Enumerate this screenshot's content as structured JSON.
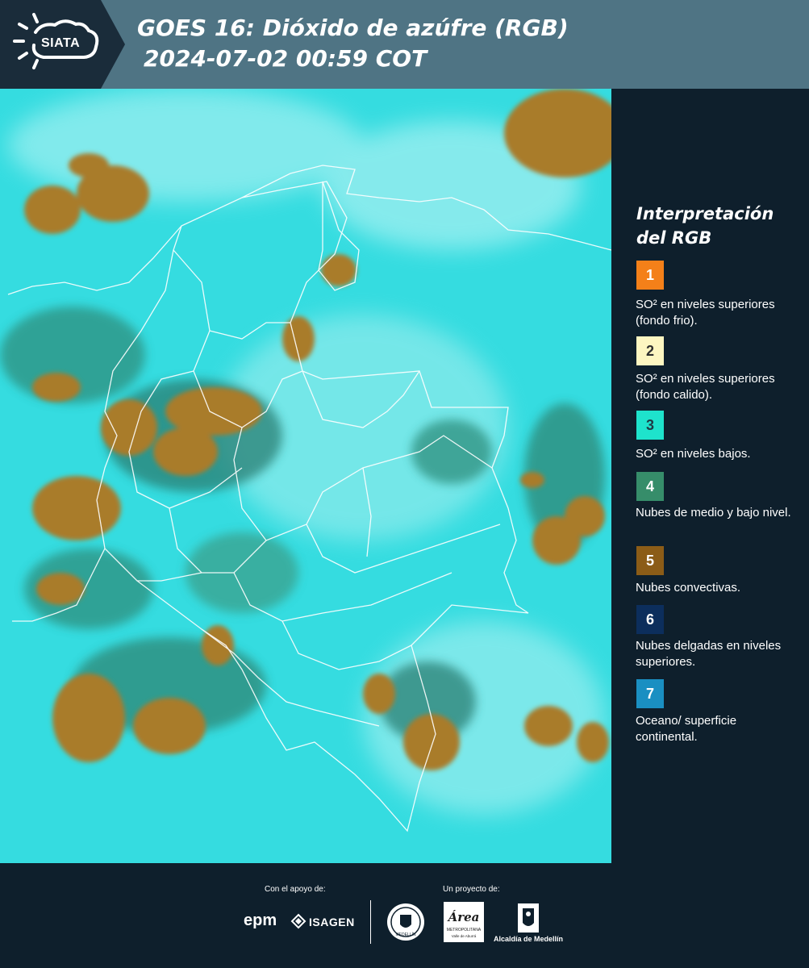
{
  "header": {
    "logo_text": "SIATA",
    "title_line1": "GOES 16: Dióxido de azúfre (RGB)",
    "title_line2": "2024-07-02 00:59 COT"
  },
  "map": {
    "ocean_background_color": "#35dce0",
    "convective_cloud_color": "#a97c2c",
    "border_color": "#ffffff"
  },
  "legend": {
    "title": "Interpretación del RGB",
    "items": [
      {
        "number": "1",
        "color": "#f48019",
        "text_color": "#ffffff",
        "label": "SO² en niveles superiores (fondo frio)."
      },
      {
        "number": "2",
        "color": "#fdf6c1",
        "text_color": "#2e2e2e",
        "label": "SO² en niveles superiores (fondo calido)."
      },
      {
        "number": "3",
        "color": "#1ee3cc",
        "text_color": "#1e3b44",
        "label": "SO² en niveles bajos."
      },
      {
        "number": "4",
        "color": "#368d6a",
        "text_color": "#ffffff",
        "label": "Nubes de medio y bajo nivel."
      },
      {
        "number": "5",
        "color": "#8b5c17",
        "text_color": "#ffffff",
        "label": "Nubes convectivas."
      },
      {
        "number": "6",
        "color": "#0c2e5c",
        "text_color": "#ffffff",
        "label": "Nubes delgadas en niveles superiores."
      },
      {
        "number": "7",
        "color": "#1a8fc2",
        "text_color": "#ffffff",
        "label": "Oceano/ superficie continental."
      }
    ]
  },
  "footer": {
    "support_label": "Con el apoyo de:",
    "project_label": "Un proyecto de:",
    "sponsors": [
      "epm",
      "ISAGEN"
    ],
    "area_logo_text": "Área",
    "area_logo_sub": "METROPOLITANA",
    "area_logo_sub2": "Valle de Aburrá",
    "alcaldia_label": "Alcaldía de Medellín",
    "seal_label": "MEDELLÍN"
  }
}
